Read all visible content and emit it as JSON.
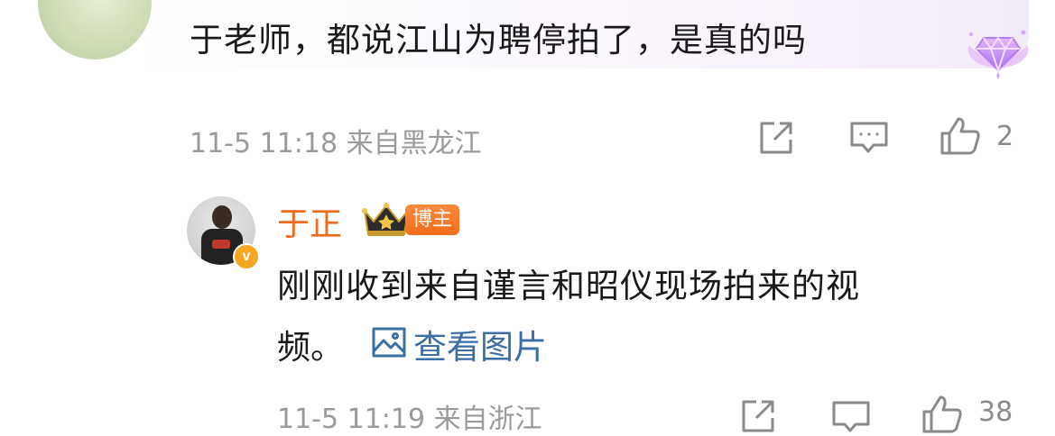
{
  "top_comment": {
    "text": "于老师，都说江山为聘停拍了，是真的吗",
    "time": "11-5 11:18",
    "location": "来自黑龙江",
    "like_count": "2",
    "icons": [
      "share-icon",
      "comment-icon",
      "like-icon",
      "vip-gem-icon"
    ]
  },
  "reply": {
    "author": "于正",
    "badge": "博主",
    "text_line_1": "刚刚收到来自谨言和昭仪现场拍来的视",
    "text_line_2": "频。",
    "view_image_label": "查看图片",
    "verified_mark": "v",
    "icons": [
      "crown-icon",
      "image-icon"
    ]
  },
  "next_meta": {
    "time": "11-5 11:19",
    "location": "来自浙江",
    "like_count": "38"
  },
  "colors": {
    "name_orange": "#f06a1e",
    "link_blue": "#3a6ea5",
    "meta_gray": "#9a9a9a",
    "badge_orange": "#f36d1c"
  }
}
